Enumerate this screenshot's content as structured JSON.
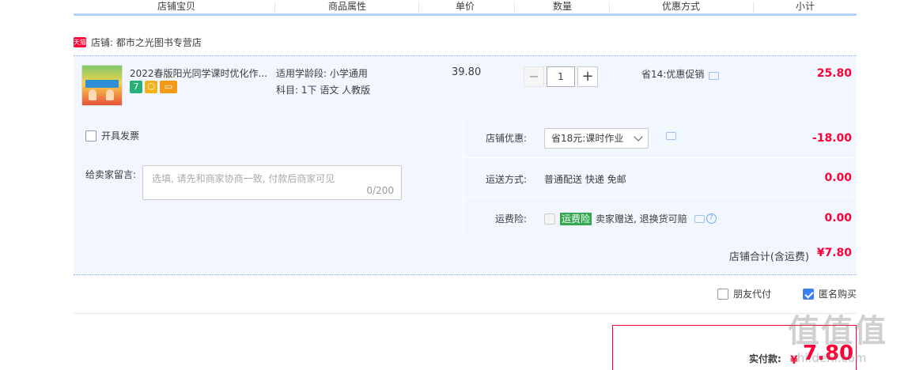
{
  "header": {
    "columns": [
      "店铺宝贝",
      "商品属性",
      "单价",
      "数量",
      "优惠方式",
      "小计"
    ]
  },
  "shop": {
    "badge": "天猫",
    "label": "店铺: 都市之光图书专营店"
  },
  "item": {
    "title": "2022春版阳光同学课时优化作...",
    "badges": [
      "7",
      "盾",
      "卡"
    ],
    "attr_line1": "适用学龄段: 小学通用",
    "attr_line2": "科目: 1下 语文 人教版",
    "price": "39.80",
    "quantity": "1",
    "minus": "−",
    "plus": "+",
    "promo": "省14:优惠促销",
    "subtotal": "25.80"
  },
  "order": {
    "invoice_label": "开具发票",
    "message_label": "给卖家留言:",
    "message_placeholder": "选填, 请先和商家协商一致, 付款后商家可见",
    "message_count": "0/200",
    "discount_label": "店铺优惠:",
    "discount_select": "省18元:课时作业",
    "discount_amount": "-18.00",
    "shipping_label": "运送方式:",
    "shipping_text": "普通配送 快递 免邮",
    "shipping_amount": "0.00",
    "insurance_label": "运费险:",
    "insurance_tag": "运费险",
    "insurance_text": "卖家赠送, 退换货可赔",
    "insurance_amount": "0.00",
    "total_label": "店铺合计(含运费)",
    "total_amount": "¥7.80"
  },
  "options": {
    "friend_pay": "朋友代付",
    "friend_pay_checked": false,
    "anonymous": "匿名购买",
    "anonymous_checked": true
  },
  "pay": {
    "label": "实付款:",
    "currency": "¥",
    "amount": "7.80"
  },
  "watermark": {
    "text": "值值值",
    "url": "zhi.dehi.com"
  },
  "colors": {
    "accent": "#ff0036",
    "header_line": "#b2d1ff",
    "panel_bg": "#f2f7ff",
    "checkbox_on": "#3d80f5",
    "insurance_tag": "#34a853"
  }
}
